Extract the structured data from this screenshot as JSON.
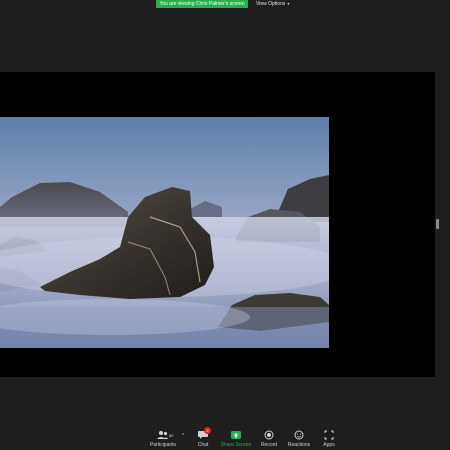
{
  "banner": {
    "text": "You are viewing Chris Palmer's screen",
    "color": "#22b14c"
  },
  "view_options": {
    "label": "View Options",
    "caret": "▾"
  },
  "shared_image": {
    "description_icon": "photo-rocks-in-mist"
  },
  "toolbar": {
    "participants": {
      "label": "Participants",
      "count": "80"
    },
    "chat": {
      "label": "Chat",
      "badge": "2"
    },
    "share_screen": {
      "label": "Share Screen",
      "color": "#22b14c"
    },
    "record": {
      "label": "Record"
    },
    "reactions": {
      "label": "Reactions"
    },
    "apps": {
      "label": "Apps"
    }
  }
}
